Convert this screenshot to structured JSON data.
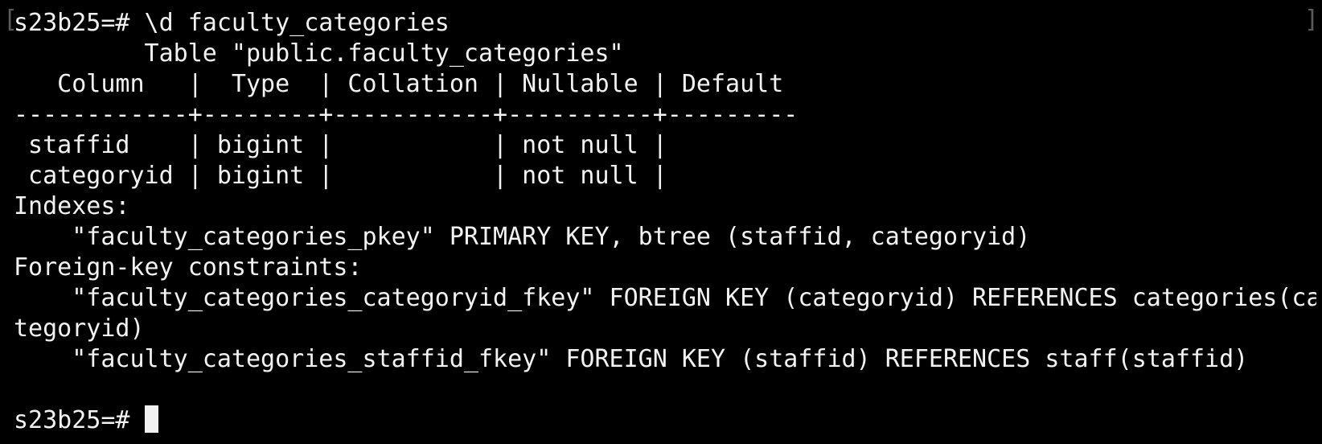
{
  "colors": {
    "background": "#000000",
    "foreground": "#f2f2f2",
    "bracket": "#5a5a5a"
  },
  "decor": {
    "left_bracket": "[",
    "right_bracket": "]"
  },
  "lines": [
    "s23b25=# \\d faculty_categories",
    "         Table \"public.faculty_categories\"",
    "   Column   |  Type  | Collation | Nullable | Default",
    "------------+--------+-----------+----------+---------",
    " staffid    | bigint |           | not null |",
    " categoryid | bigint |           | not null |",
    "Indexes:",
    "    \"faculty_categories_pkey\" PRIMARY KEY, btree (staffid, categoryid)",
    "Foreign-key constraints:",
    "    \"faculty_categories_categoryid_fkey\" FOREIGN KEY (categoryid) REFERENCES categories(ca",
    "tegoryid)",
    "    \"faculty_categories_staffid_fkey\" FOREIGN KEY (staffid) REFERENCES staff(staffid)",
    ""
  ],
  "prompt": "s23b25=# "
}
